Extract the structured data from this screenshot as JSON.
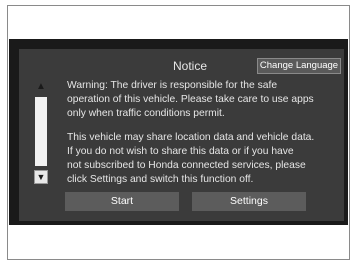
{
  "dialog": {
    "title": "Notice",
    "change_language_label": "Change Language",
    "warning_lines": [
      "Warning: The driver is responsible for the safe",
      "operation of this vehicle. Please take care to use apps",
      "only when traffic conditions permit."
    ],
    "privacy_lines": [
      "This vehicle may share location data and vehicle data.",
      "If you do not wish to share this data or if you have",
      "not subscribed to Honda connected services, please",
      "click Settings and switch this function off."
    ],
    "start_label": "Start",
    "settings_label": "Settings"
  },
  "scrollbar": {
    "up_icon": "chevron-double-up-icon",
    "down_icon": "chevron-double-down-icon"
  },
  "colors": {
    "screen_bg": "#3b3b3b",
    "button_bg": "#5c5c5c",
    "text": "#e6e6e6"
  }
}
